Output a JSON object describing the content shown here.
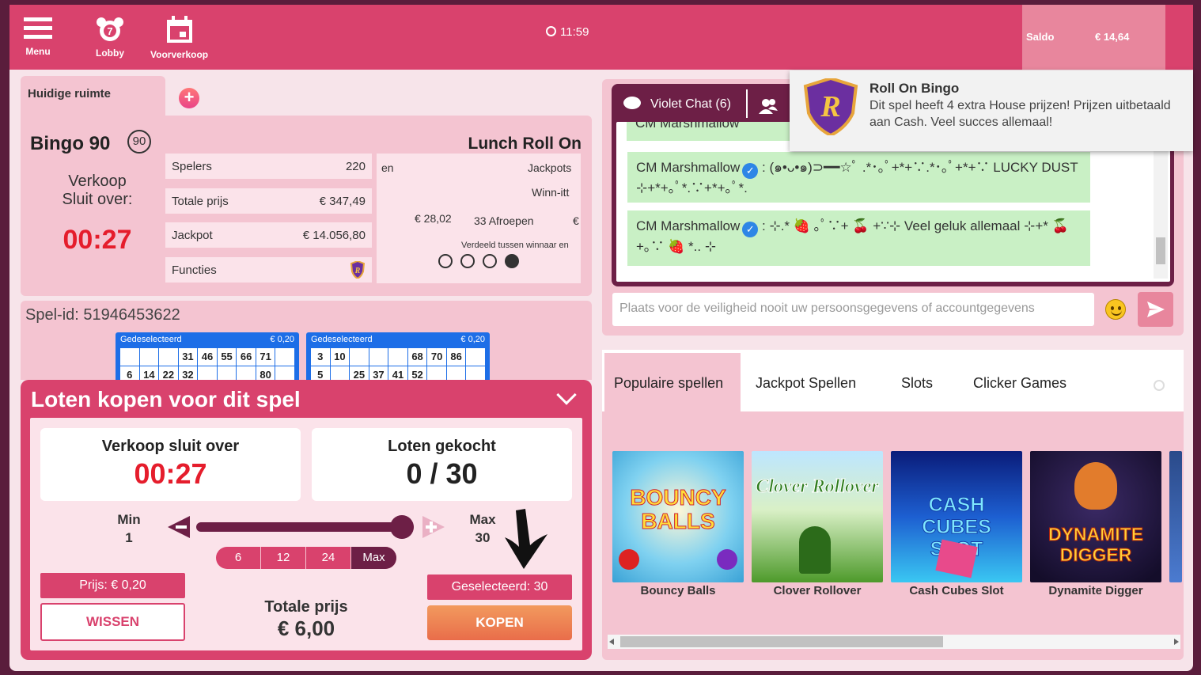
{
  "topbar": {
    "menu_label": "Menu",
    "lobby_label": "Lobby",
    "presale_label": "Voorverkoop",
    "clock": "11:59",
    "balance_label": "Saldo",
    "balance_value": "€ 14,64"
  },
  "room": {
    "tab_label": "Huidige ruimte",
    "game_name": "Bingo 90",
    "game_badge": "90",
    "sale_label_1": "Verkoop",
    "sale_label_2": "Sluit over:",
    "sale_timer": "00:27",
    "room_title": "Lunch Roll On",
    "info": [
      {
        "label": "Spelers",
        "value": "220"
      },
      {
        "label": "Totale prijs",
        "value": "€ 347,49"
      },
      {
        "label": "Jackpot",
        "value": "€ 14.056,80"
      },
      {
        "label": "Functies",
        "value": ""
      }
    ],
    "jackpot_box": {
      "t1": "en",
      "t2": "Jackpots",
      "t3": "Winn-itt",
      "t4": "€ 28,02",
      "t5": "33 Afroepen",
      "t6": "€",
      "t7": "Verdeeld tussen winnaar en"
    }
  },
  "game_id": "Spel-id: 51946453622",
  "tickets": [
    {
      "status": "Gedeselecteerd",
      "price": "€ 0,20",
      "row1": [
        "",
        "",
        "",
        "31",
        "46",
        "55",
        "66",
        "71",
        ""
      ],
      "row2": [
        "6",
        "14",
        "22",
        "32",
        "",
        "",
        "",
        "80",
        ""
      ]
    },
    {
      "status": "Gedeselecteerd",
      "price": "€ 0,20",
      "row1": [
        "3",
        "10",
        "",
        "",
        "",
        "68",
        "70",
        "86",
        ""
      ],
      "row2": [
        "5",
        "",
        "25",
        "37",
        "41",
        "52",
        "",
        "",
        ""
      ]
    }
  ],
  "buy": {
    "title": "Loten kopen voor dit spel",
    "sale_closes_label": "Verkoop sluit over",
    "sale_closes_value": "00:27",
    "bought_label": "Loten gekocht",
    "bought_value": "0 / 30",
    "min_label": "Min",
    "min_value": "1",
    "max_label": "Max",
    "max_value": "30",
    "slider_fraction": 1.0,
    "presets": [
      "6",
      "12",
      "24",
      "Max"
    ],
    "price": "Prijs: € 0,20",
    "clear": "WISSEN",
    "total_label": "Totale prijs",
    "total_value": "€ 6,00",
    "selected": "Geselecteerd: 30",
    "buy_button": "KOPEN"
  },
  "chat": {
    "tab_label": "Violet Chat (6)",
    "clipped_name": "CM Marshmallow",
    "messages": [
      {
        "name": "CM Marshmallow",
        "sep": " : ",
        "text": "(๑•ᴗ•๑)⊃━━☆ﾟ    .*･｡ﾟ+*+∵.*･｡ﾟ+*+∵ LUCKY DUST ⊹+*+｡ﾟ*.∵+*+｡ﾟ*."
      },
      {
        "name": "CM Marshmallow",
        "sep": " : ",
        "text": "⊹.* 🍓 ｡ﾟ∵+ 🍒 +∵⊹  Veel geluk allemaal  ⊹+* 🍒 +｡∵ 🍓 *.. ⊹"
      }
    ],
    "input_placeholder": "Plaats voor de veiligheid nooit uw persoonsgegevens of accountgegevens"
  },
  "toast": {
    "title": "Roll On Bingo",
    "body": "Dit spel heeft 4 extra House prijzen! Prijzen uitbetaald aan Cash. Veel succes allemaal!"
  },
  "games": {
    "tabs": [
      "Populaire spellen",
      "Jackpot Spellen",
      "Slots",
      "Clicker Games"
    ],
    "items": [
      {
        "name": "Bouncy Balls",
        "art": "BOUNCY BALLS"
      },
      {
        "name": "Clover Rollover",
        "art": "Clover Rollover"
      },
      {
        "name": "Cash Cubes Slot",
        "art": "CASH CUBES SLOT"
      },
      {
        "name": "Dynamite Digger",
        "art": "DYNAMITE DIGGER"
      }
    ]
  },
  "colors": {
    "brand": "#d9426d",
    "dark": "#6d1f46",
    "panel": "#f4c4d1",
    "timer_red": "#e51d2c",
    "chat_green": "#c9f0c5",
    "ticket_blue": "#1d6ee7"
  }
}
